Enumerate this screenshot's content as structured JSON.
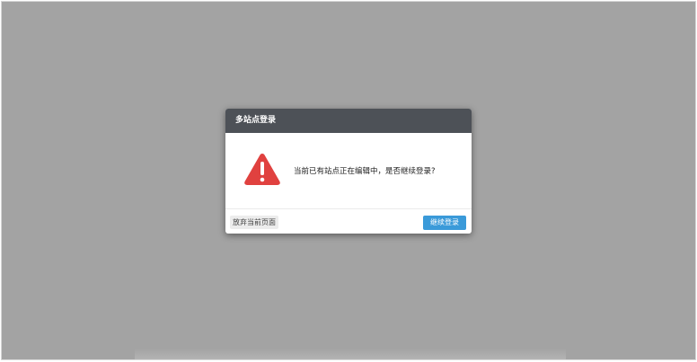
{
  "dialog": {
    "title": "多站点登录",
    "message": "当前已有站点正在编辑中，是否继续登录?",
    "icon": "warning-triangle-icon",
    "abandon_label": "放弃当前页面",
    "continue_label": "继续登录"
  },
  "colors": {
    "overlay": "#a3a3a3",
    "header": "#4d5157",
    "warning": "#e0413f",
    "primary_button": "#3a9ad9"
  }
}
